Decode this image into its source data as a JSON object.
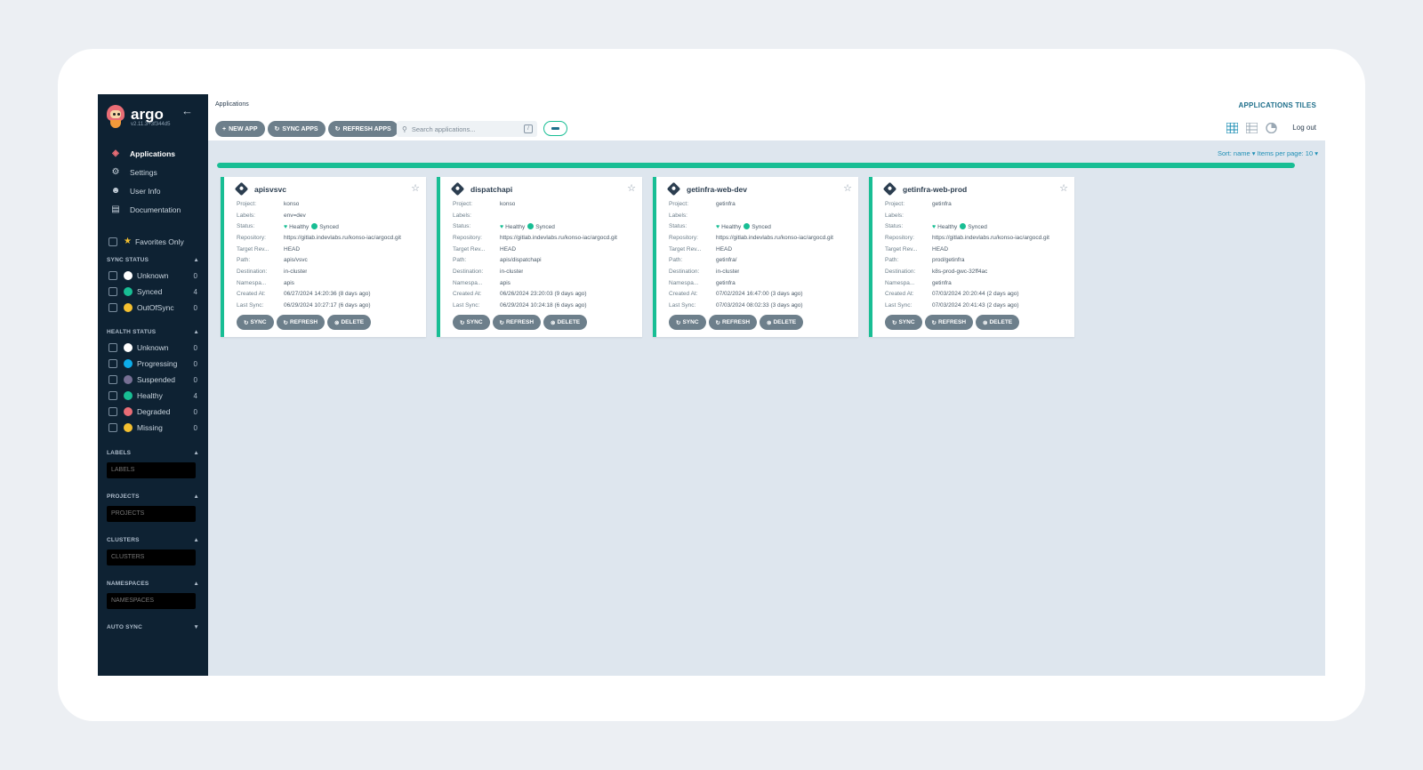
{
  "brand": {
    "name": "argo",
    "version": "v2.11.3+3f344d5"
  },
  "nav": [
    {
      "label": "Applications",
      "icon": "layers-icon"
    },
    {
      "label": "Settings",
      "icon": "gears-icon"
    },
    {
      "label": "User Info",
      "icon": "user-icon"
    },
    {
      "label": "Documentation",
      "icon": "book-icon"
    }
  ],
  "favorites": {
    "label": "Favorites Only"
  },
  "sync_status": {
    "title": "SYNC STATUS",
    "items": [
      {
        "label": "Unknown",
        "count": "0",
        "color": "#ffffff"
      },
      {
        "label": "Synced",
        "count": "4",
        "color": "#18be94"
      },
      {
        "label": "OutOfSync",
        "count": "0",
        "color": "#f4c030"
      }
    ]
  },
  "health_status": {
    "title": "HEALTH STATUS",
    "items": [
      {
        "label": "Unknown",
        "count": "0",
        "color": "#ffffff"
      },
      {
        "label": "Progressing",
        "count": "0",
        "color": "#0dadea"
      },
      {
        "label": "Suspended",
        "count": "0",
        "color": "#766f94"
      },
      {
        "label": "Healthy",
        "count": "4",
        "color": "#18be94"
      },
      {
        "label": "Degraded",
        "count": "0",
        "color": "#e96d76"
      },
      {
        "label": "Missing",
        "count": "0",
        "color": "#f4c030"
      }
    ]
  },
  "filters": {
    "labels": {
      "title": "LABELS",
      "placeholder": "LABELS"
    },
    "projects": {
      "title": "PROJECTS",
      "placeholder": "PROJECTS"
    },
    "clusters": {
      "title": "CLUSTERS",
      "placeholder": "CLUSTERS"
    },
    "namespaces": {
      "title": "NAMESPACES",
      "placeholder": "NAMESPACES"
    },
    "auto_sync": {
      "title": "AUTO SYNC"
    }
  },
  "header": {
    "breadcrumb": "Applications",
    "title": "APPLICATIONS TILES",
    "new_app": "NEW APP",
    "sync_apps": "SYNC APPS",
    "refresh_apps": "REFRESH APPS",
    "search_placeholder": "Search applications...",
    "search_key": "/",
    "logout": "Log out"
  },
  "sort": {
    "text": "Sort: name ▾ Items per page: 10 ▾"
  },
  "progress": {
    "fraction": 1.0,
    "color": "#18be94"
  },
  "field_labels": {
    "project": "Project:",
    "labels": "Labels:",
    "status": "Status:",
    "repository": "Repository:",
    "target": "Target Rev...",
    "path": "Path:",
    "destination": "Destination:",
    "namespace": "Namespa...",
    "created": "Created At:",
    "last_sync": "Last Sync:"
  },
  "card_actions": {
    "sync": "SYNC",
    "refresh": "REFRESH",
    "delete": "DELETE"
  },
  "apps": [
    {
      "name": "apisvsvc",
      "project": "konso",
      "labels": "env=dev",
      "health": "Healthy",
      "sync": "Synced",
      "repository": "https://gitlab.indevlabs.ru/konso-iac/argocd.git",
      "target": "HEAD",
      "path": "apis/vsvc",
      "destination": "in-cluster",
      "namespace": "apis",
      "created": "06/27/2024 14:20:36  (8 days ago)",
      "last_sync": "06/29/2024 10:27:17  (6 days ago)"
    },
    {
      "name": "dispatchapi",
      "project": "konso",
      "labels": "",
      "health": "Healthy",
      "sync": "Synced",
      "repository": "https://gitlab.indevlabs.ru/konso-iac/argocd.git",
      "target": "HEAD",
      "path": "apis/dispatchapi",
      "destination": "in-cluster",
      "namespace": "apis",
      "created": "06/26/2024 23:20:03  (9 days ago)",
      "last_sync": "06/29/2024 10:24:18  (6 days ago)"
    },
    {
      "name": "getinfra-web-dev",
      "project": "getinfra",
      "labels": "",
      "health": "Healthy",
      "sync": "Synced",
      "repository": "https://gitlab.indevlabs.ru/konso-iac/argocd.git",
      "target": "HEAD",
      "path": "getinfra/",
      "destination": "in-cluster",
      "namespace": "getinfra",
      "created": "07/02/2024 16:47:00  (3 days ago)",
      "last_sync": "07/03/2024 08:02:33  (3 days ago)"
    },
    {
      "name": "getinfra-web-prod",
      "project": "getinfra",
      "labels": "",
      "health": "Healthy",
      "sync": "Synced",
      "repository": "https://gitlab.indevlabs.ru/konso-iac/argocd.git",
      "target": "HEAD",
      "path": "prod/getinfra",
      "destination": "k8s-prod-gwc-32ff4ac",
      "namespace": "getinfra",
      "created": "07/03/2024 20:20:44  (2 days ago)",
      "last_sync": "07/03/2024 20:41:43  (2 days ago)"
    }
  ]
}
